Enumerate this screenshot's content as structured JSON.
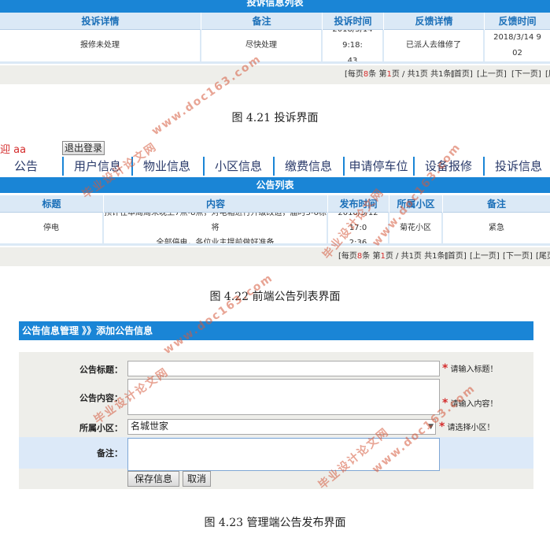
{
  "complaint_section": {
    "top_title": "投诉信息列表",
    "headers": [
      "投诉详情",
      "备注",
      "投诉时间",
      "反馈详情",
      "反馈时间"
    ],
    "row": [
      "报修未处理",
      "尽快处理",
      "2018/3/14 9:18:43",
      "已派人去维修了",
      "2018/3/14 9:02"
    ],
    "row_time_lines": [
      "2018/3/14 9:18:",
      "43"
    ],
    "row_feedback_time_lines": [
      "2018/3/14 9",
      "02"
    ],
    "pager": {
      "prefix": "[每页",
      "per_page": "8",
      "mid1": "条 第",
      "page": "1",
      "mid2": "页 / 共1页 共1条]",
      "first": "[首页]",
      "prev": "[上一页]",
      "next": "[下一页]",
      "last": "[尾"
    },
    "caption": "图 4.21 投诉界面"
  },
  "notice_section": {
    "welcome": "迎 aa",
    "logout_label": "退出登录",
    "nav": [
      "公告",
      "用户信息",
      "物业信息",
      "小区信息",
      "缴费信息",
      "申请停车位",
      "设备报修",
      "投诉信息"
    ],
    "list_title": "公告列表",
    "headers": [
      "标题",
      "内容",
      "发布时间",
      "所属小区",
      "备注"
    ],
    "row": {
      "title": "停电",
      "content_line1": "预计在本周周末晚上7点-8点，对电箱进行升级改造，届时3-6栋将",
      "content_line2": "全部停电，各位业主提前做好准备",
      "time_line1": "2018/3/12 17:0",
      "time_line2": "2:36",
      "community": "菊花小区",
      "remark": "紧急"
    },
    "pager": {
      "prefix": "[每页",
      "per_page": "8",
      "mid1": "条 第",
      "page": "1",
      "mid2": "页 / 共1页 共1条]",
      "first": "[首页]",
      "prev": "[上一页]",
      "next": "[下一页]",
      "last": "[尾页"
    },
    "caption": "图 4.22 前端公告列表界面"
  },
  "form_section": {
    "title": "公告信息管理 》》添加公告信息",
    "fields": {
      "title_label": "公告标题：",
      "title_value": "",
      "title_hint": "请输入标题！",
      "content_label": "公告内容：",
      "content_value": "",
      "content_hint": "请输入内容！",
      "community_label": "所属小区：",
      "community_value": "名城世家",
      "community_hint": "请选择小区！",
      "remark_label": "备注：",
      "remark_value": ""
    },
    "star": "*",
    "save_label": "保存信息",
    "cancel_label": "取消",
    "caption": "图 4.23 管理端公告发布界面"
  },
  "watermarks": {
    "site": "www.doc163.com",
    "cn": "毕业设计论文网"
  },
  "colors": {
    "accent_blue": "#1a85d6",
    "header_bg": "#dbe9f6",
    "header_text": "#1a6fb8",
    "highlight_red": "#d42c2c",
    "pager_bg": "#eeeeea"
  }
}
